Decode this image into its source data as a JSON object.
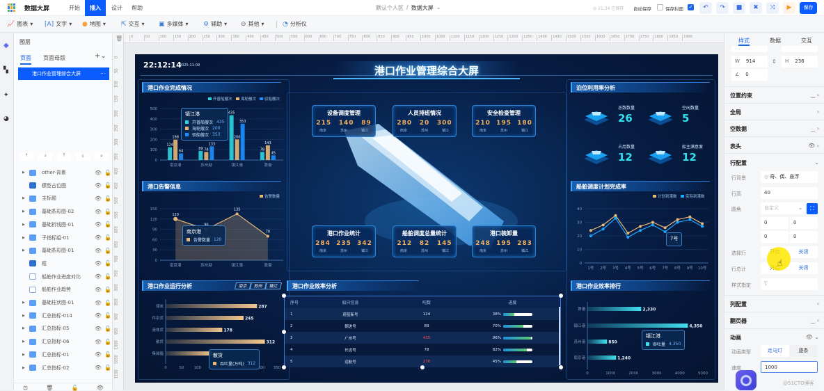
{
  "app": {
    "title": "数据大屏",
    "menus": [
      "开始",
      "插入",
      "设计",
      "帮助"
    ],
    "active_menu": "插入",
    "breadcrumb": {
      "workspace": "默认个人区",
      "separator": "/",
      "page": "数据大屏"
    },
    "save_status": "21:34 已保存",
    "auto_save": "自动保存",
    "save_cover": "保存封面",
    "save_button": "保存"
  },
  "toolbar": {
    "items": [
      "图表",
      "文字",
      "地图",
      "交互",
      "多媒体",
      "辅助",
      "其他"
    ],
    "analyzer": "分析仪"
  },
  "layers": {
    "title": "图层",
    "tabs": [
      "页面",
      "页面母版"
    ],
    "page": "港口作业管理综合大屏",
    "items": [
      {
        "name": "other-背景",
        "type": "group"
      },
      {
        "name": "模型占位图",
        "type": "image"
      },
      {
        "name": "主标题",
        "type": "group"
      },
      {
        "name": "基础条形图-02",
        "type": "group"
      },
      {
        "name": "基础折线图-01",
        "type": "group"
      },
      {
        "name": "子指标组-01",
        "type": "group"
      },
      {
        "name": "基础条形图-01",
        "type": "group"
      },
      {
        "name": "框",
        "type": "image"
      },
      {
        "name": "船舶作业进度对比",
        "type": "text"
      },
      {
        "name": "船舶作业趋势",
        "type": "chart"
      },
      {
        "name": "基础柱状图-01",
        "type": "group"
      },
      {
        "name": "汇总指标-014",
        "type": "group"
      },
      {
        "name": "汇总指标-05",
        "type": "group"
      },
      {
        "name": "汇总指标-06",
        "type": "group"
      },
      {
        "name": "汇总指标-01",
        "type": "group"
      },
      {
        "name": "汇总指标-02",
        "type": "group"
      }
    ]
  },
  "ruler": {
    "h": [
      0,
      50,
      100,
      150,
      200,
      250,
      300,
      350,
      400,
      450,
      500,
      550,
      600,
      650,
      700,
      750,
      800,
      850,
      900,
      950,
      1000,
      1050,
      1100,
      1150,
      1200,
      1250,
      1300,
      1350,
      1400,
      1450,
      1500,
      1550,
      1600,
      1650,
      1700,
      1750,
      1800,
      1850,
      1900
    ],
    "v": [
      0,
      50,
      100,
      150,
      200,
      250,
      300,
      350,
      400,
      450,
      500,
      550,
      600,
      650,
      700,
      750,
      800,
      850,
      900,
      950,
      1000,
      1050,
      1100
    ]
  },
  "dashboard": {
    "title": "港口作业管理综合大屏",
    "time": "22:12:14",
    "date": "2025-11-09",
    "panels": {
      "p1": "港口作业完成情况",
      "p2": "港口告警信息",
      "p3": "港口作业运行分析",
      "p4": "港口作业效率分析",
      "p5": "泊位利用率分析",
      "p6": "船舶调度计划完成率",
      "p7": "港口作业效率排行"
    },
    "p3_tabs": [
      "南京",
      "苏州",
      "镇江"
    ],
    "cards": [
      {
        "title": "设备调度管理",
        "values": [
          "215",
          "140",
          "89"
        ]
      },
      {
        "title": "人员排班情况",
        "values": [
          "280",
          "20",
          "300"
        ]
      },
      {
        "title": "安全检查管理",
        "values": [
          "210",
          "195",
          "180"
        ]
      },
      {
        "title": "港口作业统计",
        "values": [
          "284",
          "235",
          "342"
        ]
      },
      {
        "title": "船舶调度总量统计",
        "values": [
          "212",
          "82",
          "145"
        ]
      },
      {
        "title": "港口装卸量",
        "values": [
          "248",
          "195",
          "283"
        ]
      }
    ],
    "card_labels": [
      "南京",
      "苏州",
      "镇江"
    ],
    "kpis": [
      {
        "label": "总数数量",
        "value": "26"
      },
      {
        "label": "空闲数量",
        "value": "5"
      },
      {
        "label": "占用数量",
        "value": "12"
      },
      {
        "label": "船主满意度",
        "value": "12"
      }
    ],
    "table": {
      "headers": [
        "序号",
        "船只信息",
        "吨数",
        "进度"
      ],
      "rows": [
        {
          "no": "1",
          "name": "蔚蓝新号",
          "tons": "124",
          "progress": "38%",
          "pct": 38,
          "alert": false
        },
        {
          "no": "2",
          "name": "朝进号",
          "tons": "89",
          "progress": "70%",
          "pct": 70,
          "alert": false
        },
        {
          "no": "3",
          "name": "广州号",
          "tons": "435",
          "progress": "96%",
          "pct": 96,
          "alert": true
        },
        {
          "no": "4",
          "name": "长远号",
          "tons": "78",
          "progress": "82%",
          "pct": 82,
          "alert": false
        },
        {
          "no": "5",
          "name": "远航号",
          "tons": "276",
          "progress": "45%",
          "pct": 45,
          "alert": true
        }
      ]
    },
    "colors": {
      "cyan": "#2fd3e0",
      "tan": "#e8b878",
      "blue": "#1e8fff",
      "alert": "#ff4d4f"
    },
    "tooltips": {
      "t1": {
        "title": "镇江港",
        "rows": [
          [
            "开普船艘次",
            "435"
          ],
          [
            "海轮艘次",
            "200"
          ],
          [
            "驳船艘次",
            "353"
          ]
        ]
      },
      "t2": {
        "title": "南京港",
        "rows": [
          [
            "告警数量",
            "120"
          ]
        ]
      },
      "t3": {
        "title": "散货",
        "rows": [
          [
            "吞吐量(万吨)",
            "312"
          ]
        ]
      },
      "t4": {
        "title": "7号"
      },
      "t5": {
        "title": "镇江港",
        "rows": [
          [
            "吞吐量",
            "4,350"
          ]
        ]
      }
    }
  },
  "chart_data": [
    {
      "type": "bar",
      "id": "c1",
      "categories": [
        "南京港",
        "苏州港",
        "镇江港",
        "滁港"
      ],
      "ylim": [
        0,
        500
      ],
      "yticks": [
        0,
        100,
        200,
        300,
        400,
        500
      ],
      "legend": "top-right",
      "series": [
        {
          "name": "开普船艘次",
          "values": [
            124,
            89,
            435,
            78
          ],
          "color": "#2fd3e0"
        },
        {
          "name": "海轮艘次",
          "values": [
            198,
            78,
            200,
            143
          ],
          "color": "#e8b878"
        },
        {
          "name": "驳船艘次",
          "values": [
            64,
            133,
            353,
            45
          ],
          "color": "#1e8fff"
        }
      ]
    },
    {
      "type": "area",
      "id": "c2",
      "categories": [
        "南京港",
        "苏州港",
        "镇江港",
        "滁港"
      ],
      "ylim": [
        0,
        150
      ],
      "yticks": [
        0,
        30,
        60,
        90,
        120,
        150
      ],
      "legend": "top-right",
      "series": [
        {
          "name": "告警数量",
          "values": [
            120,
            90,
            135,
            70
          ],
          "color": "#e8b878"
        }
      ]
    },
    {
      "type": "bar",
      "orientation": "horizontal",
      "id": "c3",
      "categories": [
        "煤炭",
        "件杂货",
        "液体货",
        "散货",
        "集装箱"
      ],
      "values": [
        287,
        245,
        178,
        312,
        146
      ],
      "xlim": [
        0,
        350
      ],
      "xticks": [
        0,
        50,
        100,
        150,
        200,
        250,
        300,
        350
      ],
      "series_name": "吞吐量(万吨)"
    },
    {
      "type": "line",
      "id": "c4",
      "categories": [
        "1号",
        "2号",
        "3号",
        "4号",
        "5号",
        "6号",
        "7号",
        "8号",
        "9号",
        "10号"
      ],
      "ylim": [
        0,
        40
      ],
      "yticks": [
        0,
        10,
        20,
        30,
        40
      ],
      "legend": "top-right",
      "series": [
        {
          "name": "计划到港数",
          "values": [
            24,
            28,
            35,
            22,
            27,
            30,
            26,
            32,
            34,
            29
          ],
          "color": "#e8b878"
        },
        {
          "name": "实际到港数",
          "values": [
            20,
            25,
            33,
            19,
            24,
            28,
            23,
            30,
            32,
            27
          ],
          "color": "#1ea7ff"
        }
      ]
    },
    {
      "type": "bar",
      "orientation": "horizontal",
      "id": "c5",
      "categories": [
        "滁港",
        "镇江港",
        "苏州港",
        "南京港"
      ],
      "values": [
        2330,
        4350,
        850,
        1240
      ],
      "labels": [
        "2,330",
        "4,350",
        "850",
        "1,240"
      ],
      "xlim": [
        0,
        5000
      ],
      "xticks": [
        0,
        1000,
        2000,
        3000,
        4000,
        5000
      ],
      "series_name": "吞吐量"
    }
  ],
  "props": {
    "tabs": [
      "样式",
      "数据",
      "交互"
    ],
    "w_label": "W",
    "w": "914",
    "h_label": "H",
    "h": "236",
    "angle": "0",
    "sections": {
      "pos": "位置约束",
      "global": "全局",
      "empty": "空数据",
      "header": "表头",
      "row": "行配置",
      "col": "列配置",
      "pager": "翻页器",
      "anim": "动画"
    },
    "row_bg_label": "行背景",
    "row_bg": "奇、偶、悬浮",
    "row_h_label": "行高",
    "row_h": "40",
    "radius_label": "圆角",
    "radius": "自定义",
    "radius_vals": [
      "0",
      "0",
      "0",
      "0"
    ],
    "select_label": "选择行",
    "total_label": "行总计",
    "on": "开启",
    "off": "关闭",
    "style_label": "样式指定",
    "anim_type_label": "动画类型",
    "anim_types": [
      "走马灯",
      "逐条"
    ],
    "speed_label": "速度",
    "speed": "1000"
  },
  "watermark": "@51CTO博客"
}
